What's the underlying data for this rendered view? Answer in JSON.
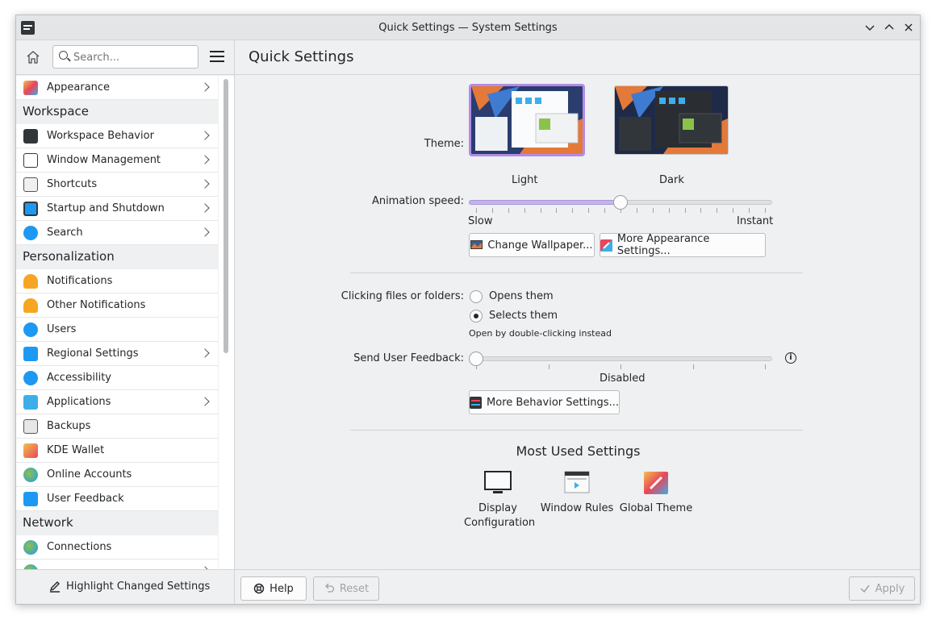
{
  "window": {
    "title": "Quick Settings — System Settings"
  },
  "search": {
    "placeholder": "Search..."
  },
  "sidebar": {
    "items": [
      {
        "label": "Appearance",
        "type": "item",
        "chevron": true,
        "icon": "appearance-icon"
      },
      {
        "label": "Workspace",
        "type": "category"
      },
      {
        "label": "Workspace Behavior",
        "type": "item",
        "chevron": true,
        "icon": "workspace-behavior-icon"
      },
      {
        "label": "Window Management",
        "type": "item",
        "chevron": true,
        "icon": "window-management-icon"
      },
      {
        "label": "Shortcuts",
        "type": "item",
        "chevron": true,
        "icon": "keyboard-icon"
      },
      {
        "label": "Startup and Shutdown",
        "type": "item",
        "chevron": true,
        "icon": "startup-icon"
      },
      {
        "label": "Search",
        "type": "item",
        "chevron": true,
        "icon": "search-icon"
      },
      {
        "label": "Personalization",
        "type": "category"
      },
      {
        "label": "Notifications",
        "type": "item",
        "chevron": false,
        "icon": "bell-icon"
      },
      {
        "label": "Other Notifications",
        "type": "item",
        "chevron": false,
        "icon": "bell-icon"
      },
      {
        "label": "Users",
        "type": "item",
        "chevron": false,
        "icon": "users-icon"
      },
      {
        "label": "Regional Settings",
        "type": "item",
        "chevron": true,
        "icon": "regional-icon"
      },
      {
        "label": "Accessibility",
        "type": "item",
        "chevron": false,
        "icon": "accessibility-icon"
      },
      {
        "label": "Applications",
        "type": "item",
        "chevron": true,
        "icon": "applications-icon"
      },
      {
        "label": "Backups",
        "type": "item",
        "chevron": false,
        "icon": "backup-icon"
      },
      {
        "label": "KDE Wallet",
        "type": "item",
        "chevron": false,
        "icon": "wallet-icon"
      },
      {
        "label": "Online Accounts",
        "type": "item",
        "chevron": false,
        "icon": "globe-icon"
      },
      {
        "label": "User Feedback",
        "type": "item",
        "chevron": false,
        "icon": "feedback-icon"
      },
      {
        "label": "Network",
        "type": "category"
      },
      {
        "label": "Connections",
        "type": "item",
        "chevron": false,
        "icon": "globe-icon"
      },
      {
        "label": "",
        "type": "item",
        "chevron": true,
        "icon": "globe-icon"
      }
    ],
    "highlight_label": "Highlight Changed Settings"
  },
  "main": {
    "title": "Quick Settings",
    "theme": {
      "label": "Theme:",
      "options": [
        "Light",
        "Dark"
      ],
      "selected": "Light"
    },
    "animation": {
      "label": "Animation speed:",
      "min_label": "Slow",
      "max_label": "Instant",
      "value": 0.5
    },
    "change_wallpaper": "Change Wallpaper...",
    "more_appearance": "More Appearance Settings...",
    "clicking": {
      "label": "Clicking files or folders:",
      "opt1": "Opens them",
      "opt2": "Selects them",
      "hint": "Open by double-clicking instead",
      "selected": "Selects them"
    },
    "feedback": {
      "label": "Send User Feedback:",
      "value_label": "Disabled",
      "value": 0
    },
    "more_behavior": "More Behavior Settings...",
    "most_used": {
      "title": "Most Used Settings",
      "items": [
        {
          "label": "Display Configuration",
          "icon": "display-icon"
        },
        {
          "label": "Window Rules",
          "icon": "window-rules-icon"
        },
        {
          "label": "Global Theme",
          "icon": "global-theme-icon"
        }
      ]
    }
  },
  "footer": {
    "help": "Help",
    "reset": "Reset",
    "apply": "Apply"
  },
  "colors": {
    "accent": "#a895d8",
    "selection_border": "#b28ce6"
  }
}
